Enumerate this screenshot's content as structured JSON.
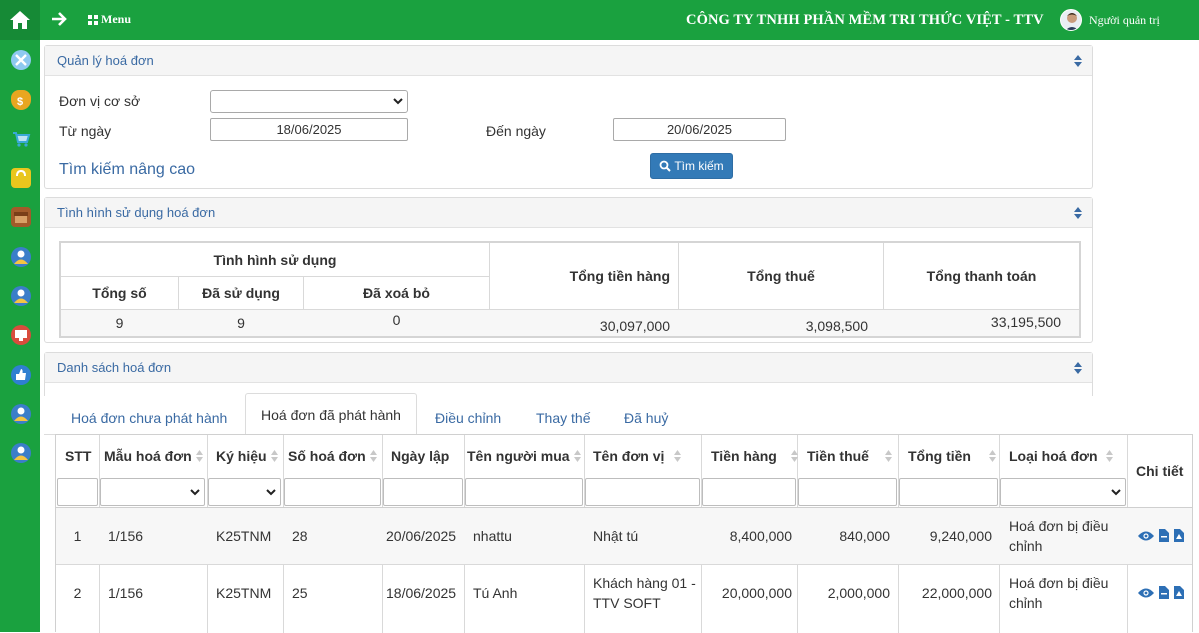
{
  "header": {
    "menu_label": "Menu",
    "company": "CÔNG TY TNHH PHẦN MỀM TRI THỨC VIỆT - TTV",
    "user": "Người quản trị"
  },
  "sidebar": {
    "icons": [
      {
        "name": "tools-icon",
        "color": "#8ec9f0"
      },
      {
        "name": "money-bag-icon",
        "color": "#e9a620"
      },
      {
        "name": "cart-icon",
        "color": "#3aa9d8"
      },
      {
        "name": "shopping-bag-icon",
        "color": "#e9c61d"
      },
      {
        "name": "box-icon",
        "color": "#a25a2a"
      },
      {
        "name": "user-icon",
        "color": "#3b7ec9"
      },
      {
        "name": "user-icon",
        "color": "#3b7ec9"
      },
      {
        "name": "register-icon",
        "color": "#d94c3d"
      },
      {
        "name": "thumbs-up-icon",
        "color": "#2f7fd1"
      },
      {
        "name": "user-icon",
        "color": "#3b7ec9"
      },
      {
        "name": "user-icon",
        "color": "#3b7ec9"
      }
    ]
  },
  "search_panel": {
    "title": "Quản lý hoá đơn",
    "unit_label": "Đơn vị cơ sở",
    "unit_value": "",
    "from_label": "Từ ngày",
    "from_value": "18/06/2025",
    "to_label": "Đến ngày",
    "to_value": "20/06/2025",
    "advanced_link": "Tìm kiếm nâng cao",
    "search_button": "Tìm kiếm"
  },
  "usage_panel": {
    "title": "Tình hình sử dụng hoá đơn",
    "group_header": "Tình hình sử dụng",
    "col_total": "Tổng số",
    "col_used": "Đã sử dụng",
    "col_deleted": "Đã xoá bỏ",
    "col_goods": "Tổng tiền hàng",
    "col_tax": "Tổng thuế",
    "col_payment": "Tổng thanh toán",
    "total": "9",
    "used": "9",
    "deleted": "0",
    "goods": "30,097,000",
    "tax": "3,098,500",
    "payment": "33,195,500"
  },
  "list_panel": {
    "title": "Danh sách hoá đơn",
    "tabs": [
      "Hoá đơn chưa phát hành",
      "Hoá đơn đã phát hành",
      "Điều chỉnh",
      "Thay thế",
      "Đã huỷ"
    ],
    "active_tab": "Hoá đơn đã phát hành",
    "columns": [
      "STT",
      "Mẫu hoá đơn",
      "Ký hiệu",
      "Số hoá đơn",
      "Ngày lập",
      "Tên người mua",
      "Tên đơn vị",
      "Tiền hàng",
      "Tiền thuế",
      "Tổng tiền",
      "Loại hoá đơn",
      "Chi tiết"
    ],
    "rows": [
      {
        "stt": "1",
        "template": "1/156",
        "symbol": "K25TNM",
        "number": "28",
        "date": "20/06/2025",
        "buyer": "nhattu",
        "unit": "Nhật tú",
        "goods": "8,400,000",
        "tax": "840,000",
        "total": "9,240,000",
        "type": "Hoá đơn bị điều chỉnh"
      },
      {
        "stt": "2",
        "template": "1/156",
        "symbol": "K25TNM",
        "number": "25",
        "date": "18/06/2025",
        "buyer": "Tú Anh",
        "unit": "Khách hàng 01 - TTV SOFT",
        "goods": "20,000,000",
        "tax": "2,000,000",
        "total": "22,000,000",
        "type": "Hoá đơn bị điều chỉnh"
      }
    ]
  }
}
